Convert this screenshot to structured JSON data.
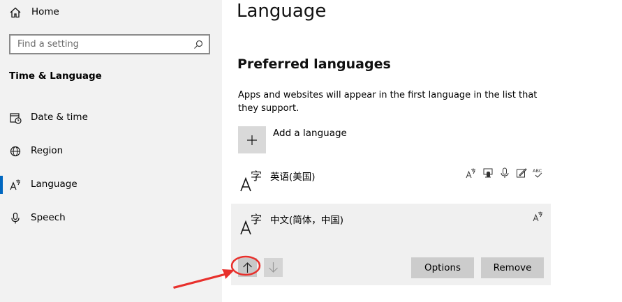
{
  "sidebar": {
    "home_label": "Home",
    "search_placeholder": "Find a setting",
    "section_title": "Time & Language",
    "items": [
      {
        "label": "Date & time",
        "icon": "calendar-clock-icon"
      },
      {
        "label": "Region",
        "icon": "globe-icon"
      },
      {
        "label": "Language",
        "icon": "language-icon",
        "active": true
      },
      {
        "label": "Speech",
        "icon": "microphone-icon"
      }
    ]
  },
  "main": {
    "title": "Language",
    "preferred_title": "Preferred languages",
    "description": "Apps and websites will appear in the first language in the list that they support.",
    "add_language_label": "Add a language",
    "languages": [
      {
        "name": "英语(美国)",
        "features": [
          "display-language-icon",
          "text-to-speech-icon",
          "speech-recognition-icon",
          "handwriting-icon",
          "spell-check-icon"
        ]
      },
      {
        "name": "中文(简体，中国)",
        "features": [
          "display-language-icon"
        ]
      }
    ],
    "options_label": "Options",
    "remove_label": "Remove"
  },
  "colors": {
    "sidebar_bg": "#f2f2f2",
    "accent": "#0067c0",
    "annotation": "#e8302c"
  }
}
